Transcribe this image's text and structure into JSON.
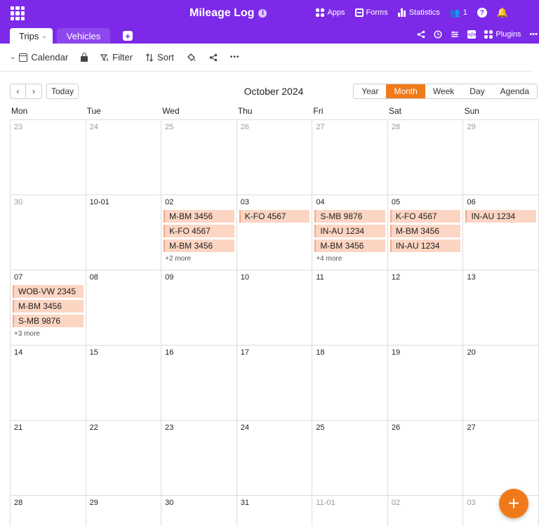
{
  "app": {
    "title": "Mileage Log",
    "accent_color": "#7c2ae8",
    "info_icon": "i"
  },
  "top_actions": [
    {
      "label": "Apps",
      "icon": "apps-icon"
    },
    {
      "label": "Forms",
      "icon": "forms-icon"
    },
    {
      "label": "Statistics",
      "icon": "statistics-icon"
    },
    {
      "label": "1",
      "icon": "collaborators-icon"
    }
  ],
  "tabs": {
    "active": "Trips",
    "other": "Vehicles",
    "add": "+"
  },
  "right_tools": {
    "plugins_label": "Plugins",
    "more": "•••"
  },
  "toolbar": {
    "view_name": "Calendar",
    "filter_label": "Filter",
    "sort_label": "Sort",
    "more": "•••"
  },
  "calendar": {
    "month_title": "October 2024",
    "today_label": "Today",
    "prev": "‹",
    "next": "›",
    "views": [
      "Year",
      "Month",
      "Week",
      "Day",
      "Agenda"
    ],
    "active_view": "Month",
    "active_color": "#f07a1a",
    "event_color": "#fcd5c3",
    "weekdays": [
      "Mon",
      "Tue",
      "Wed",
      "Thu",
      "Fri",
      "Sat",
      "Sun"
    ],
    "weeks": [
      [
        {
          "label": "23",
          "other": true,
          "events": []
        },
        {
          "label": "24",
          "other": true,
          "events": []
        },
        {
          "label": "25",
          "other": true,
          "events": []
        },
        {
          "label": "26",
          "other": true,
          "events": []
        },
        {
          "label": "27",
          "other": true,
          "events": []
        },
        {
          "label": "28",
          "other": true,
          "events": []
        },
        {
          "label": "29",
          "other": true,
          "events": []
        }
      ],
      [
        {
          "label": "30",
          "other": true,
          "events": []
        },
        {
          "label": "10-01",
          "other": false,
          "events": []
        },
        {
          "label": "02",
          "other": false,
          "events": [
            "M-BM 3456",
            "K-FO 4567",
            "M-BM 3456"
          ],
          "more": "+2 more"
        },
        {
          "label": "03",
          "other": false,
          "events": [
            "K-FO 4567"
          ]
        },
        {
          "label": "04",
          "other": false,
          "events": [
            "S-MB 9876",
            "IN-AU 1234",
            "M-BM 3456"
          ],
          "more": "+4 more"
        },
        {
          "label": "05",
          "other": false,
          "events": [
            "K-FO 4567",
            "M-BM 3456",
            "IN-AU 1234"
          ]
        },
        {
          "label": "06",
          "other": false,
          "events": [
            "IN-AU 1234"
          ]
        }
      ],
      [
        {
          "label": "07",
          "other": false,
          "events": [
            "WOB-VW 2345",
            "M-BM 3456",
            "S-MB 9876"
          ],
          "more": "+3 more"
        },
        {
          "label": "08",
          "other": false,
          "events": []
        },
        {
          "label": "09",
          "other": false,
          "events": []
        },
        {
          "label": "10",
          "other": false,
          "events": []
        },
        {
          "label": "11",
          "other": false,
          "events": []
        },
        {
          "label": "12",
          "other": false,
          "events": []
        },
        {
          "label": "13",
          "other": false,
          "events": []
        }
      ],
      [
        {
          "label": "14",
          "other": false,
          "events": []
        },
        {
          "label": "15",
          "other": false,
          "events": []
        },
        {
          "label": "16",
          "other": false,
          "events": []
        },
        {
          "label": "17",
          "other": false,
          "events": []
        },
        {
          "label": "18",
          "other": false,
          "events": []
        },
        {
          "label": "19",
          "other": false,
          "events": []
        },
        {
          "label": "20",
          "other": false,
          "events": []
        }
      ],
      [
        {
          "label": "21",
          "other": false,
          "events": []
        },
        {
          "label": "22",
          "other": false,
          "events": []
        },
        {
          "label": "23",
          "other": false,
          "events": []
        },
        {
          "label": "24",
          "other": false,
          "events": []
        },
        {
          "label": "25",
          "other": false,
          "events": []
        },
        {
          "label": "26",
          "other": false,
          "events": []
        },
        {
          "label": "27",
          "other": false,
          "events": []
        }
      ],
      [
        {
          "label": "28",
          "other": false,
          "events": []
        },
        {
          "label": "29",
          "other": false,
          "events": []
        },
        {
          "label": "30",
          "other": false,
          "events": []
        },
        {
          "label": "31",
          "other": false,
          "events": []
        },
        {
          "label": "11-01",
          "other": true,
          "events": []
        },
        {
          "label": "02",
          "other": true,
          "events": []
        },
        {
          "label": "03",
          "other": true,
          "events": []
        }
      ]
    ]
  },
  "fab_label": "+"
}
